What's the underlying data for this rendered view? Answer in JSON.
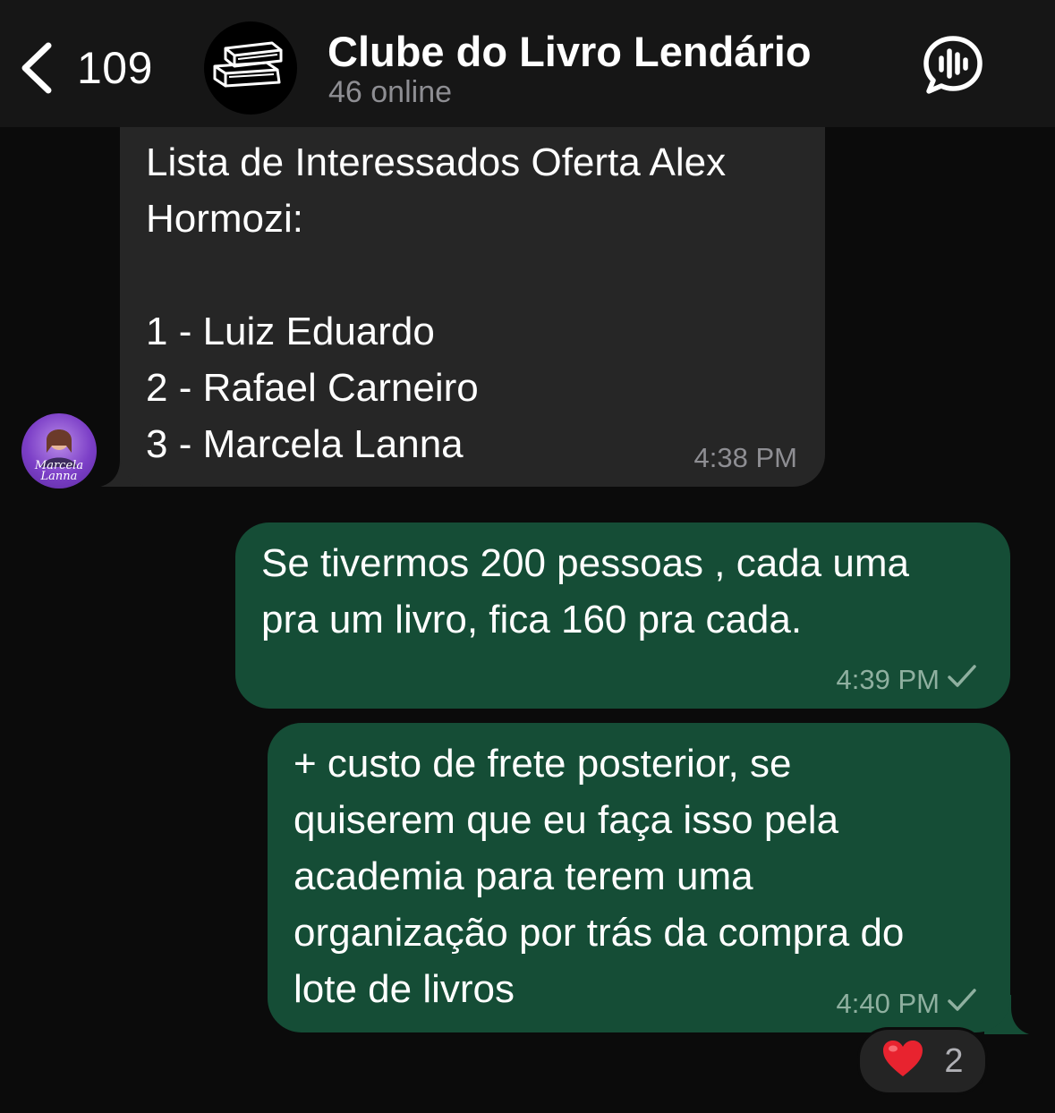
{
  "header": {
    "back_count": "109",
    "title": "Clube do Livro Lendário",
    "status": "46 online"
  },
  "messages": [
    {
      "direction": "incoming",
      "lines": [
        "Lista de Interessados Oferta Alex",
        "Hormozi:",
        "",
        "1 - Luiz Eduardo",
        "2 - Rafael Carneiro",
        "3 - Marcela Lanna"
      ],
      "time": "4:38 PM",
      "sender_avatar_text": "Marcela Lanna"
    },
    {
      "direction": "outgoing",
      "lines": [
        "Se tivermos 200 pessoas , cada uma",
        "pra um livro, fica 160 pra cada."
      ],
      "time": "4:39 PM",
      "status": "sent"
    },
    {
      "direction": "outgoing",
      "lines": [
        "+ custo de frete posterior, se",
        "quiserem que eu faça isso pela",
        "academia para terem uma",
        "organização por trás da compra do",
        "lote de livros"
      ],
      "time": "4:40 PM",
      "status": "sent",
      "reaction": {
        "emoji": "❤️",
        "icon": "heart-icon",
        "count": "2"
      }
    }
  ],
  "colors": {
    "background": "#0b0b0b",
    "header": "#161616",
    "incoming_bubble": "#262626",
    "outgoing_bubble": "#154d36",
    "reaction_heart": "#e8232f"
  },
  "icons": {
    "back": "chevron-left-icon",
    "group_avatar": "books-icon",
    "call": "voice-chat-icon",
    "check": "check-icon"
  }
}
